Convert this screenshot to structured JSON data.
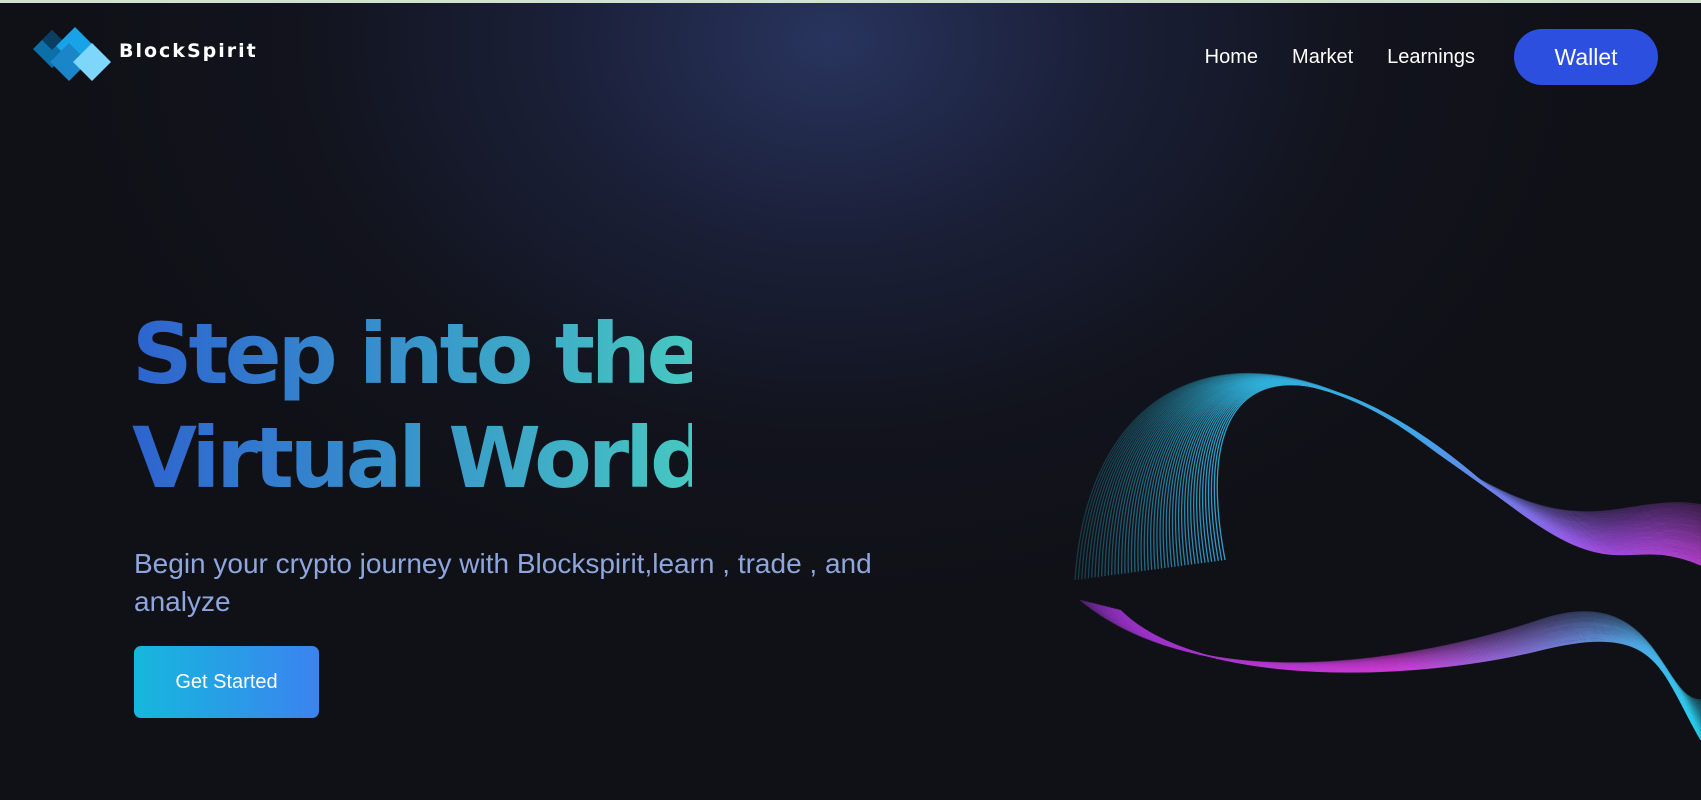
{
  "header": {
    "brand": "BlockSpirit",
    "logo_icon": "diamond-blocks-icon",
    "nav": [
      {
        "label": "Home"
      },
      {
        "label": "Market"
      },
      {
        "label": "Learnings"
      }
    ],
    "wallet_label": "Wallet"
  },
  "hero": {
    "title_line1": "Step into the",
    "title_line2": "Virtual World",
    "subtitle": "Begin your crypto journey with Blockspirit,learn , trade , and analyze",
    "cta_label": "Get Started"
  },
  "colors": {
    "background": "#101117",
    "accent_blue": "#2c4fe0",
    "title_gradient_start": "#2e63cf",
    "title_gradient_end": "#46c8c1",
    "wave_cyan": "#22d3ee",
    "wave_magenta": "#e83ae0"
  }
}
